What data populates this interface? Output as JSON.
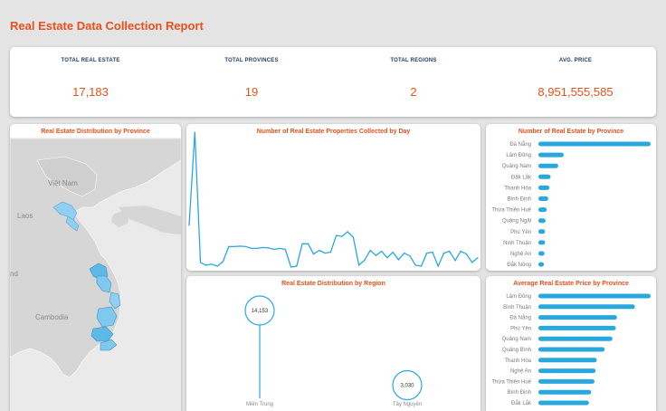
{
  "report": {
    "title": "Real Estate Data Collection Report"
  },
  "kpis": [
    {
      "label": "TOTAL REAL ESTATE",
      "value": "17,183"
    },
    {
      "label": "TOTAL PROVINCES",
      "value": "19"
    },
    {
      "label": "TOTAL REGIONS",
      "value": "2"
    },
    {
      "label": "AVG. PRICE",
      "value": "8,951,555,585"
    }
  ],
  "map": {
    "title": "Real Estate Distribution by Province",
    "labels": [
      "Việt Nam",
      "Laos",
      "Cambodia",
      "nd"
    ]
  },
  "colors": {
    "accent": "#e8501c",
    "bar": "#29a8e0",
    "kpi_label": "#1f3b5c",
    "map_land": "#d6d6d6",
    "map_highlight": "#8fd0f2"
  },
  "chart_data": [
    {
      "type": "line",
      "title": "Number of Real Estate Properties Collected by Day",
      "values": [
        90,
        290,
        10,
        4,
        6,
        2,
        12,
        44,
        44,
        45,
        44,
        40,
        40,
        42,
        41,
        38,
        40,
        38,
        0,
        2,
        50,
        50,
        28,
        36,
        30,
        32,
        68,
        66,
        76,
        64,
        4,
        15,
        36,
        25,
        34,
        20,
        32,
        16,
        30,
        24,
        4,
        2,
        30,
        32,
        2,
        30,
        34,
        14,
        34,
        28,
        10,
        20
      ]
    },
    {
      "type": "bar",
      "title": "Number of Real Estate by Province",
      "categories": [
        "Đà Nẵng",
        "Lâm Đồng",
        "Quảng Nam",
        "Đắk Lắk",
        "Thanh Hóa",
        "Bình Định",
        "Thừa Thiên Huế",
        "Quảng Ngãi",
        "Phú Yên",
        "Ninh Thuận",
        "Nghệ An",
        "Đắk Nông"
      ],
      "values": [
        10200,
        2300,
        1800,
        1100,
        1000,
        900,
        750,
        650,
        600,
        600,
        550,
        500
      ]
    },
    {
      "type": "scatter",
      "title": "Real Estate Distribution by Region",
      "categories": [
        "Miền Trung",
        "Tây Nguyên"
      ],
      "values": [
        14153,
        3030
      ],
      "labels": [
        "14,153",
        "3,030"
      ]
    },
    {
      "type": "bar",
      "title": "Average Real Estate Price by Province",
      "categories": [
        "Lâm Đồng",
        "Bình Thuận",
        "Đà Nẵng",
        "Phú Yên",
        "Quảng Nam",
        "Quảng Bình",
        "Thanh Hóa",
        "Nghệ An",
        "Thừa Thiên Huế",
        "Bình Định",
        "Đắk Lắk"
      ],
      "values": [
        100,
        86,
        70,
        69,
        66,
        59,
        52,
        51,
        50,
        47,
        45
      ]
    }
  ]
}
